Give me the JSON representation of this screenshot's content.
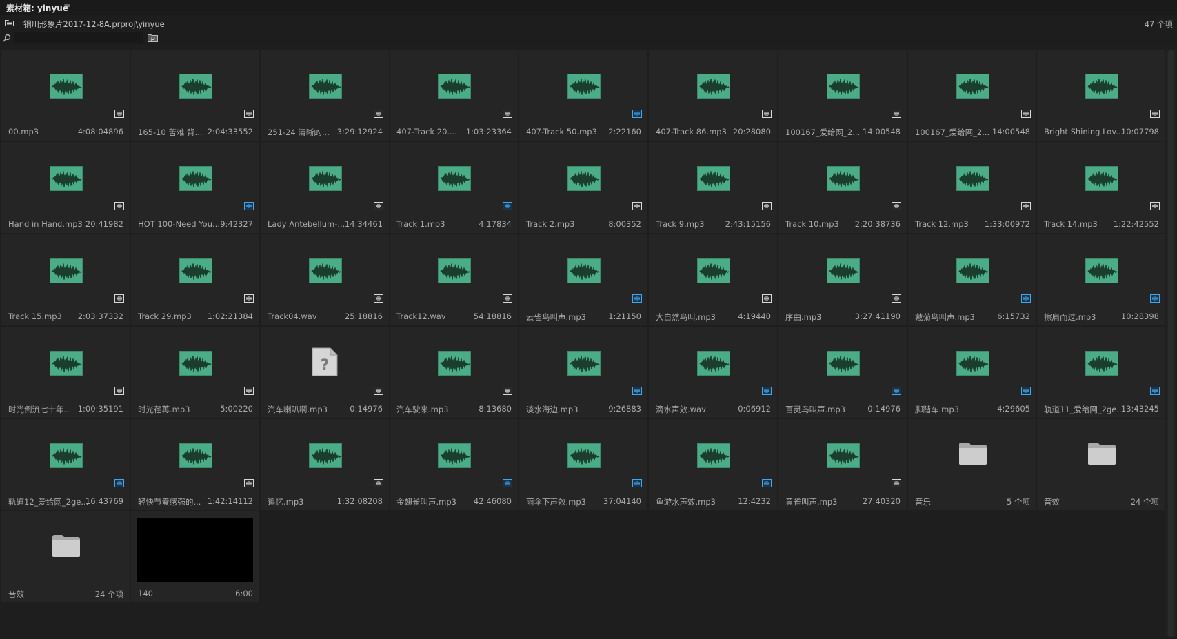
{
  "window": {
    "title": "素材箱: yinyue",
    "menu_glyph": "≡"
  },
  "path": "铜川形象片2017-12-8A.prproj\\yinyue",
  "item_count": "47 个项",
  "search": {
    "value": "",
    "placeholder": ""
  },
  "colors": {
    "waveform_bg": "#4bad88",
    "badge_blue": "#3ea7ef",
    "badge_white": "#d8d8d8"
  },
  "items": [
    {
      "name": "00.mp3",
      "meta": "4:08:04896",
      "kind": "audio",
      "badge": "white"
    },
    {
      "name": "165-10 苦难 背...",
      "meta": "2:04:33552",
      "kind": "audio",
      "badge": "white"
    },
    {
      "name": "251-24 清晰的...",
      "meta": "3:29:12924",
      "kind": "audio",
      "badge": "white"
    },
    {
      "name": "407-Track 20....",
      "meta": "1:03:23364",
      "kind": "audio",
      "badge": "white"
    },
    {
      "name": "407-Track 50.mp3",
      "meta": "2:22160",
      "kind": "audio",
      "badge": "blue"
    },
    {
      "name": "407-Track 86.mp3",
      "meta": "20:28080",
      "kind": "audio",
      "badge": "white"
    },
    {
      "name": "100167_爱给网_2...",
      "meta": "14:00548",
      "kind": "audio",
      "badge": "white"
    },
    {
      "name": "100167_爱给网_2...",
      "meta": "14:00548",
      "kind": "audio",
      "badge": "white"
    },
    {
      "name": "Bright Shining Lov...",
      "meta": "10:07798",
      "kind": "audio",
      "badge": "white"
    },
    {
      "name": "Hand in Hand.mp3",
      "meta": "20:41982",
      "kind": "audio",
      "badge": "white"
    },
    {
      "name": "HOT 100-Need You...",
      "meta": "9:42327",
      "kind": "audio",
      "badge": "blue"
    },
    {
      "name": "Lady Antebellum-...",
      "meta": "14:34461",
      "kind": "audio",
      "badge": "white"
    },
    {
      "name": "Track 1.mp3",
      "meta": "4:17834",
      "kind": "audio",
      "badge": "blue"
    },
    {
      "name": "Track 2.mp3",
      "meta": "8:00352",
      "kind": "audio",
      "badge": "white"
    },
    {
      "name": "Track 9.mp3",
      "meta": "2:43:15156",
      "kind": "audio",
      "badge": "white"
    },
    {
      "name": "Track 10.mp3",
      "meta": "2:20:38736",
      "kind": "audio",
      "badge": "white"
    },
    {
      "name": "Track 12.mp3",
      "meta": "1:33:00972",
      "kind": "audio",
      "badge": "white"
    },
    {
      "name": "Track 14.mp3",
      "meta": "1:22:42552",
      "kind": "audio",
      "badge": "white"
    },
    {
      "name": "Track 15.mp3",
      "meta": "2:03:37332",
      "kind": "audio",
      "badge": "white"
    },
    {
      "name": "Track 29.mp3",
      "meta": "1:02:21384",
      "kind": "audio",
      "badge": "white"
    },
    {
      "name": "Track04.wav",
      "meta": "25:18816",
      "kind": "audio",
      "badge": "white"
    },
    {
      "name": "Track12.wav",
      "meta": "54:18816",
      "kind": "audio",
      "badge": "white"
    },
    {
      "name": "云雀鸟叫声.mp3",
      "meta": "1:21150",
      "kind": "audio",
      "badge": "blue"
    },
    {
      "name": "大自然鸟叫.mp3",
      "meta": "4:19440",
      "kind": "audio",
      "badge": "white"
    },
    {
      "name": "序曲.mp3",
      "meta": "3:27:41190",
      "kind": "audio",
      "badge": "white"
    },
    {
      "name": "戴菊鸟叫声.mp3",
      "meta": "6:15732",
      "kind": "audio",
      "badge": "blue"
    },
    {
      "name": "擦肩而过.mp3",
      "meta": "10:28398",
      "kind": "audio",
      "badge": "blue"
    },
    {
      "name": "时光倒流七十年...",
      "meta": "1:00:35191",
      "kind": "audio",
      "badge": "white"
    },
    {
      "name": "时光荏苒.mp3",
      "meta": "5:00220",
      "kind": "audio",
      "badge": "white"
    },
    {
      "name": "汽车喇叭啊.mp3",
      "meta": "0:14976",
      "kind": "unknown",
      "badge": "white"
    },
    {
      "name": "汽车驶来.mp3",
      "meta": "8:13680",
      "kind": "audio",
      "badge": "white"
    },
    {
      "name": "淡水海边.mp3",
      "meta": "9:26883",
      "kind": "audio",
      "badge": "blue"
    },
    {
      "name": "滴水声效.wav",
      "meta": "0:06912",
      "kind": "audio",
      "badge": "blue"
    },
    {
      "name": "百灵鸟叫声.mp3",
      "meta": "0:14976",
      "kind": "audio",
      "badge": "blue"
    },
    {
      "name": "脚踏车.mp3",
      "meta": "4:29605",
      "kind": "audio",
      "badge": "blue"
    },
    {
      "name": "轨道11_爱给网_2ge...",
      "meta": "13:43245",
      "kind": "audio",
      "badge": "blue"
    },
    {
      "name": "轨道12_爱给网_2ge...",
      "meta": "16:43769",
      "kind": "audio",
      "badge": "blue"
    },
    {
      "name": "轻快节奏感强的...",
      "meta": "1:42:14112",
      "kind": "audio",
      "badge": "white"
    },
    {
      "name": "追忆.mp3",
      "meta": "1:32:08208",
      "kind": "audio",
      "badge": "white"
    },
    {
      "name": "金翅雀叫声.mp3",
      "meta": "42:46080",
      "kind": "audio",
      "badge": "blue"
    },
    {
      "name": "雨伞下声效.mp3",
      "meta": "37:04140",
      "kind": "audio",
      "badge": "blue"
    },
    {
      "name": "鱼游水声效.mp3",
      "meta": "12:4232",
      "kind": "audio",
      "badge": "blue"
    },
    {
      "name": "黄雀叫声.mp3",
      "meta": "27:40320",
      "kind": "audio",
      "badge": "white"
    },
    {
      "name": "音乐",
      "meta": "5 个项",
      "kind": "folder",
      "badge": ""
    },
    {
      "name": "音效",
      "meta": "24 个项",
      "kind": "folder",
      "badge": ""
    },
    {
      "name": "音效",
      "meta": "24 个项",
      "kind": "folder",
      "badge": ""
    },
    {
      "name": "140",
      "meta": "6:00",
      "kind": "video",
      "badge": ""
    }
  ]
}
